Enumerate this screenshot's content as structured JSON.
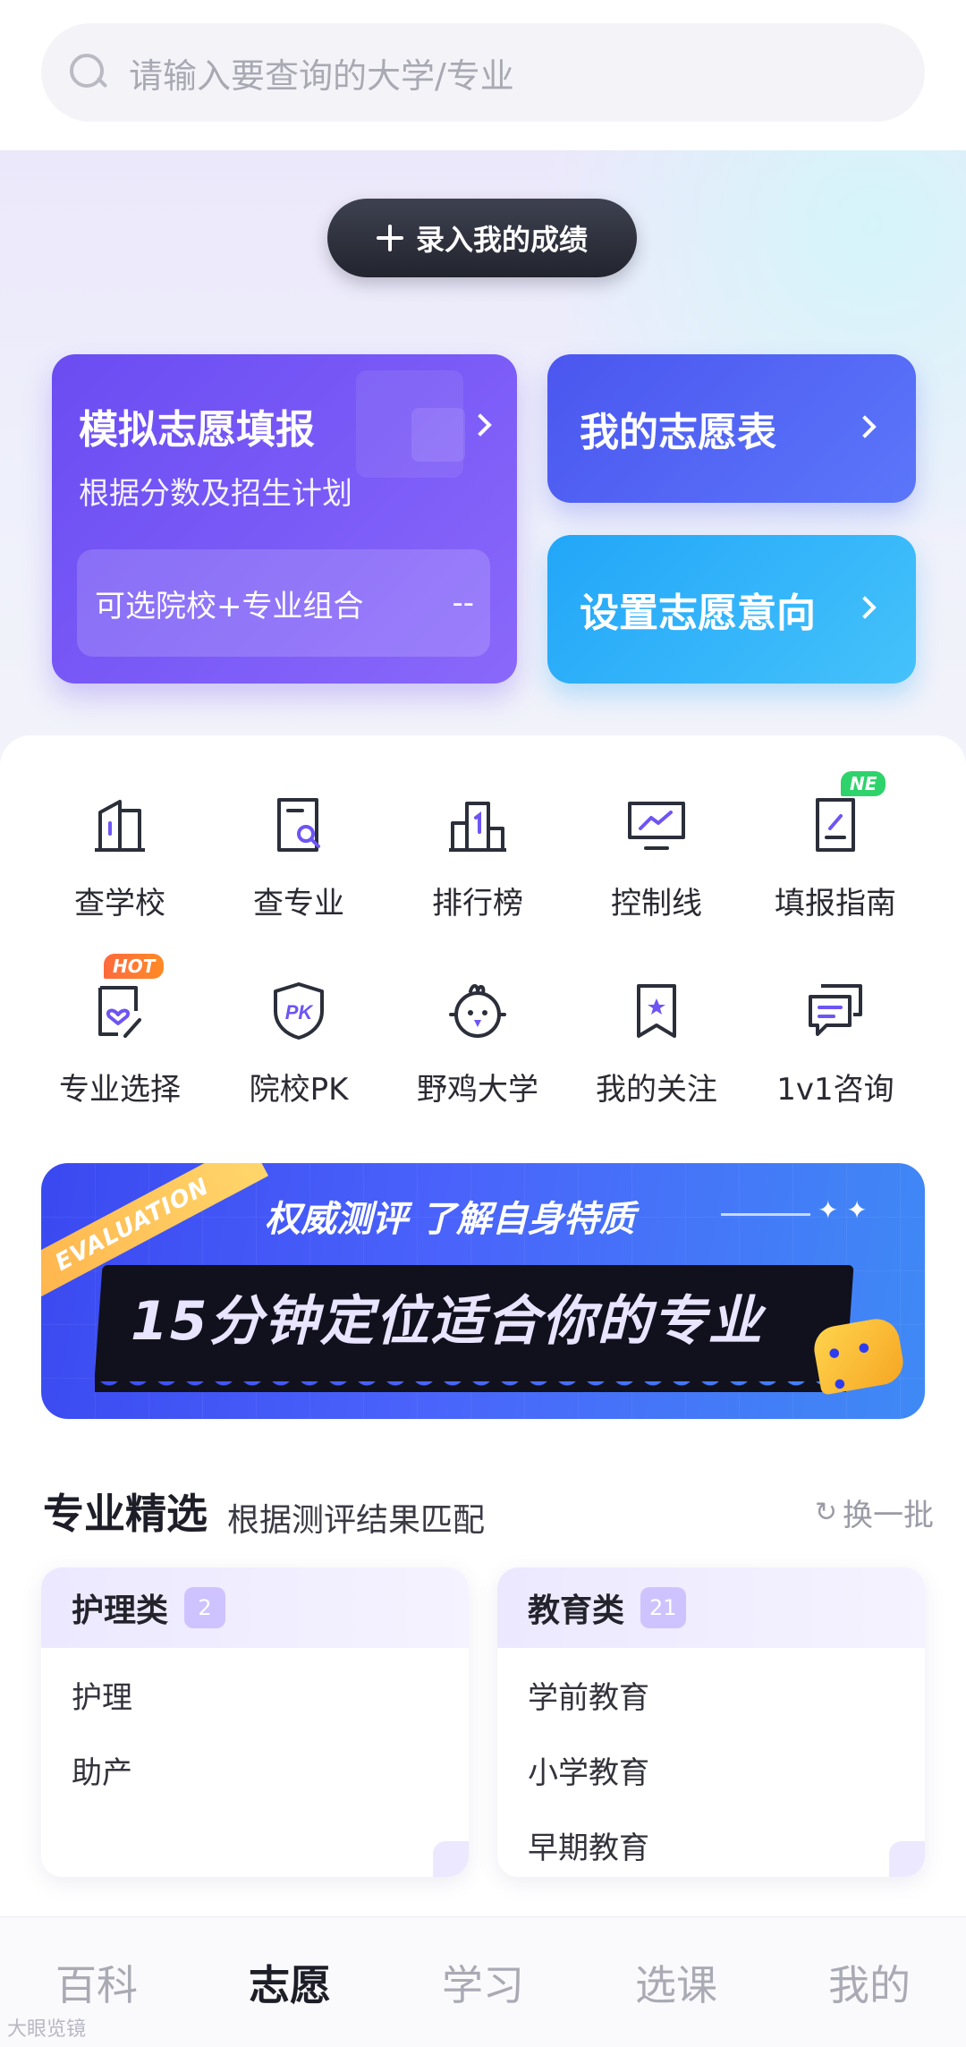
{
  "search": {
    "placeholder": "请输入要查询的大学/专业"
  },
  "hero": {
    "score_button": "录入我的成绩",
    "sim_card": {
      "title": "模拟志愿填报",
      "subtitle": "根据分数及招生计划",
      "combo_label": "可选院校+专业组合",
      "combo_value": "--"
    },
    "my_table": "我的志愿表",
    "set_intent": "设置志愿意向"
  },
  "features": [
    {
      "label": "查学校",
      "icon": "school-building-icon"
    },
    {
      "label": "查专业",
      "icon": "major-search-icon"
    },
    {
      "label": "排行榜",
      "icon": "ranking-icon"
    },
    {
      "label": "控制线",
      "icon": "control-line-chart-icon"
    },
    {
      "label": "填报指南",
      "icon": "guide-edit-icon",
      "badge": "NE"
    },
    {
      "label": "专业选择",
      "icon": "heart-document-icon",
      "badge": "HOT"
    },
    {
      "label": "院校PK",
      "icon": "pk-shield-icon"
    },
    {
      "label": "野鸡大学",
      "icon": "chicken-icon"
    },
    {
      "label": "我的关注",
      "icon": "bookmark-star-icon"
    },
    {
      "label": "1v1咨询",
      "icon": "chat-consult-icon"
    }
  ],
  "banner": {
    "ribbon": "EVALUATION",
    "top_text": "权威测评 了解自身特质",
    "stars": "✦ ✦",
    "main_text": "15分钟定位适合你的专业"
  },
  "majors": {
    "title": "专业精选",
    "subtitle": "根据测评结果匹配",
    "refresh": "换一批",
    "cards": [
      {
        "name": "护理类",
        "count": "2",
        "items": [
          "护理",
          "助产"
        ]
      },
      {
        "name": "教育类",
        "count": "21",
        "items": [
          "学前教育",
          "小学教育",
          "早期教育"
        ]
      }
    ]
  },
  "tabs": [
    "百科",
    "志愿",
    "学习",
    "选课",
    "我的"
  ],
  "active_tab": "志愿",
  "watermark": "大眼览镜",
  "colors": {
    "accent_purple": "#6a4cf2",
    "accent_blue": "#4b56ef",
    "accent_cyan": "#22a6f8",
    "icon_stroke": "#2b2f3a",
    "icon_accent": "#6d55f4"
  }
}
